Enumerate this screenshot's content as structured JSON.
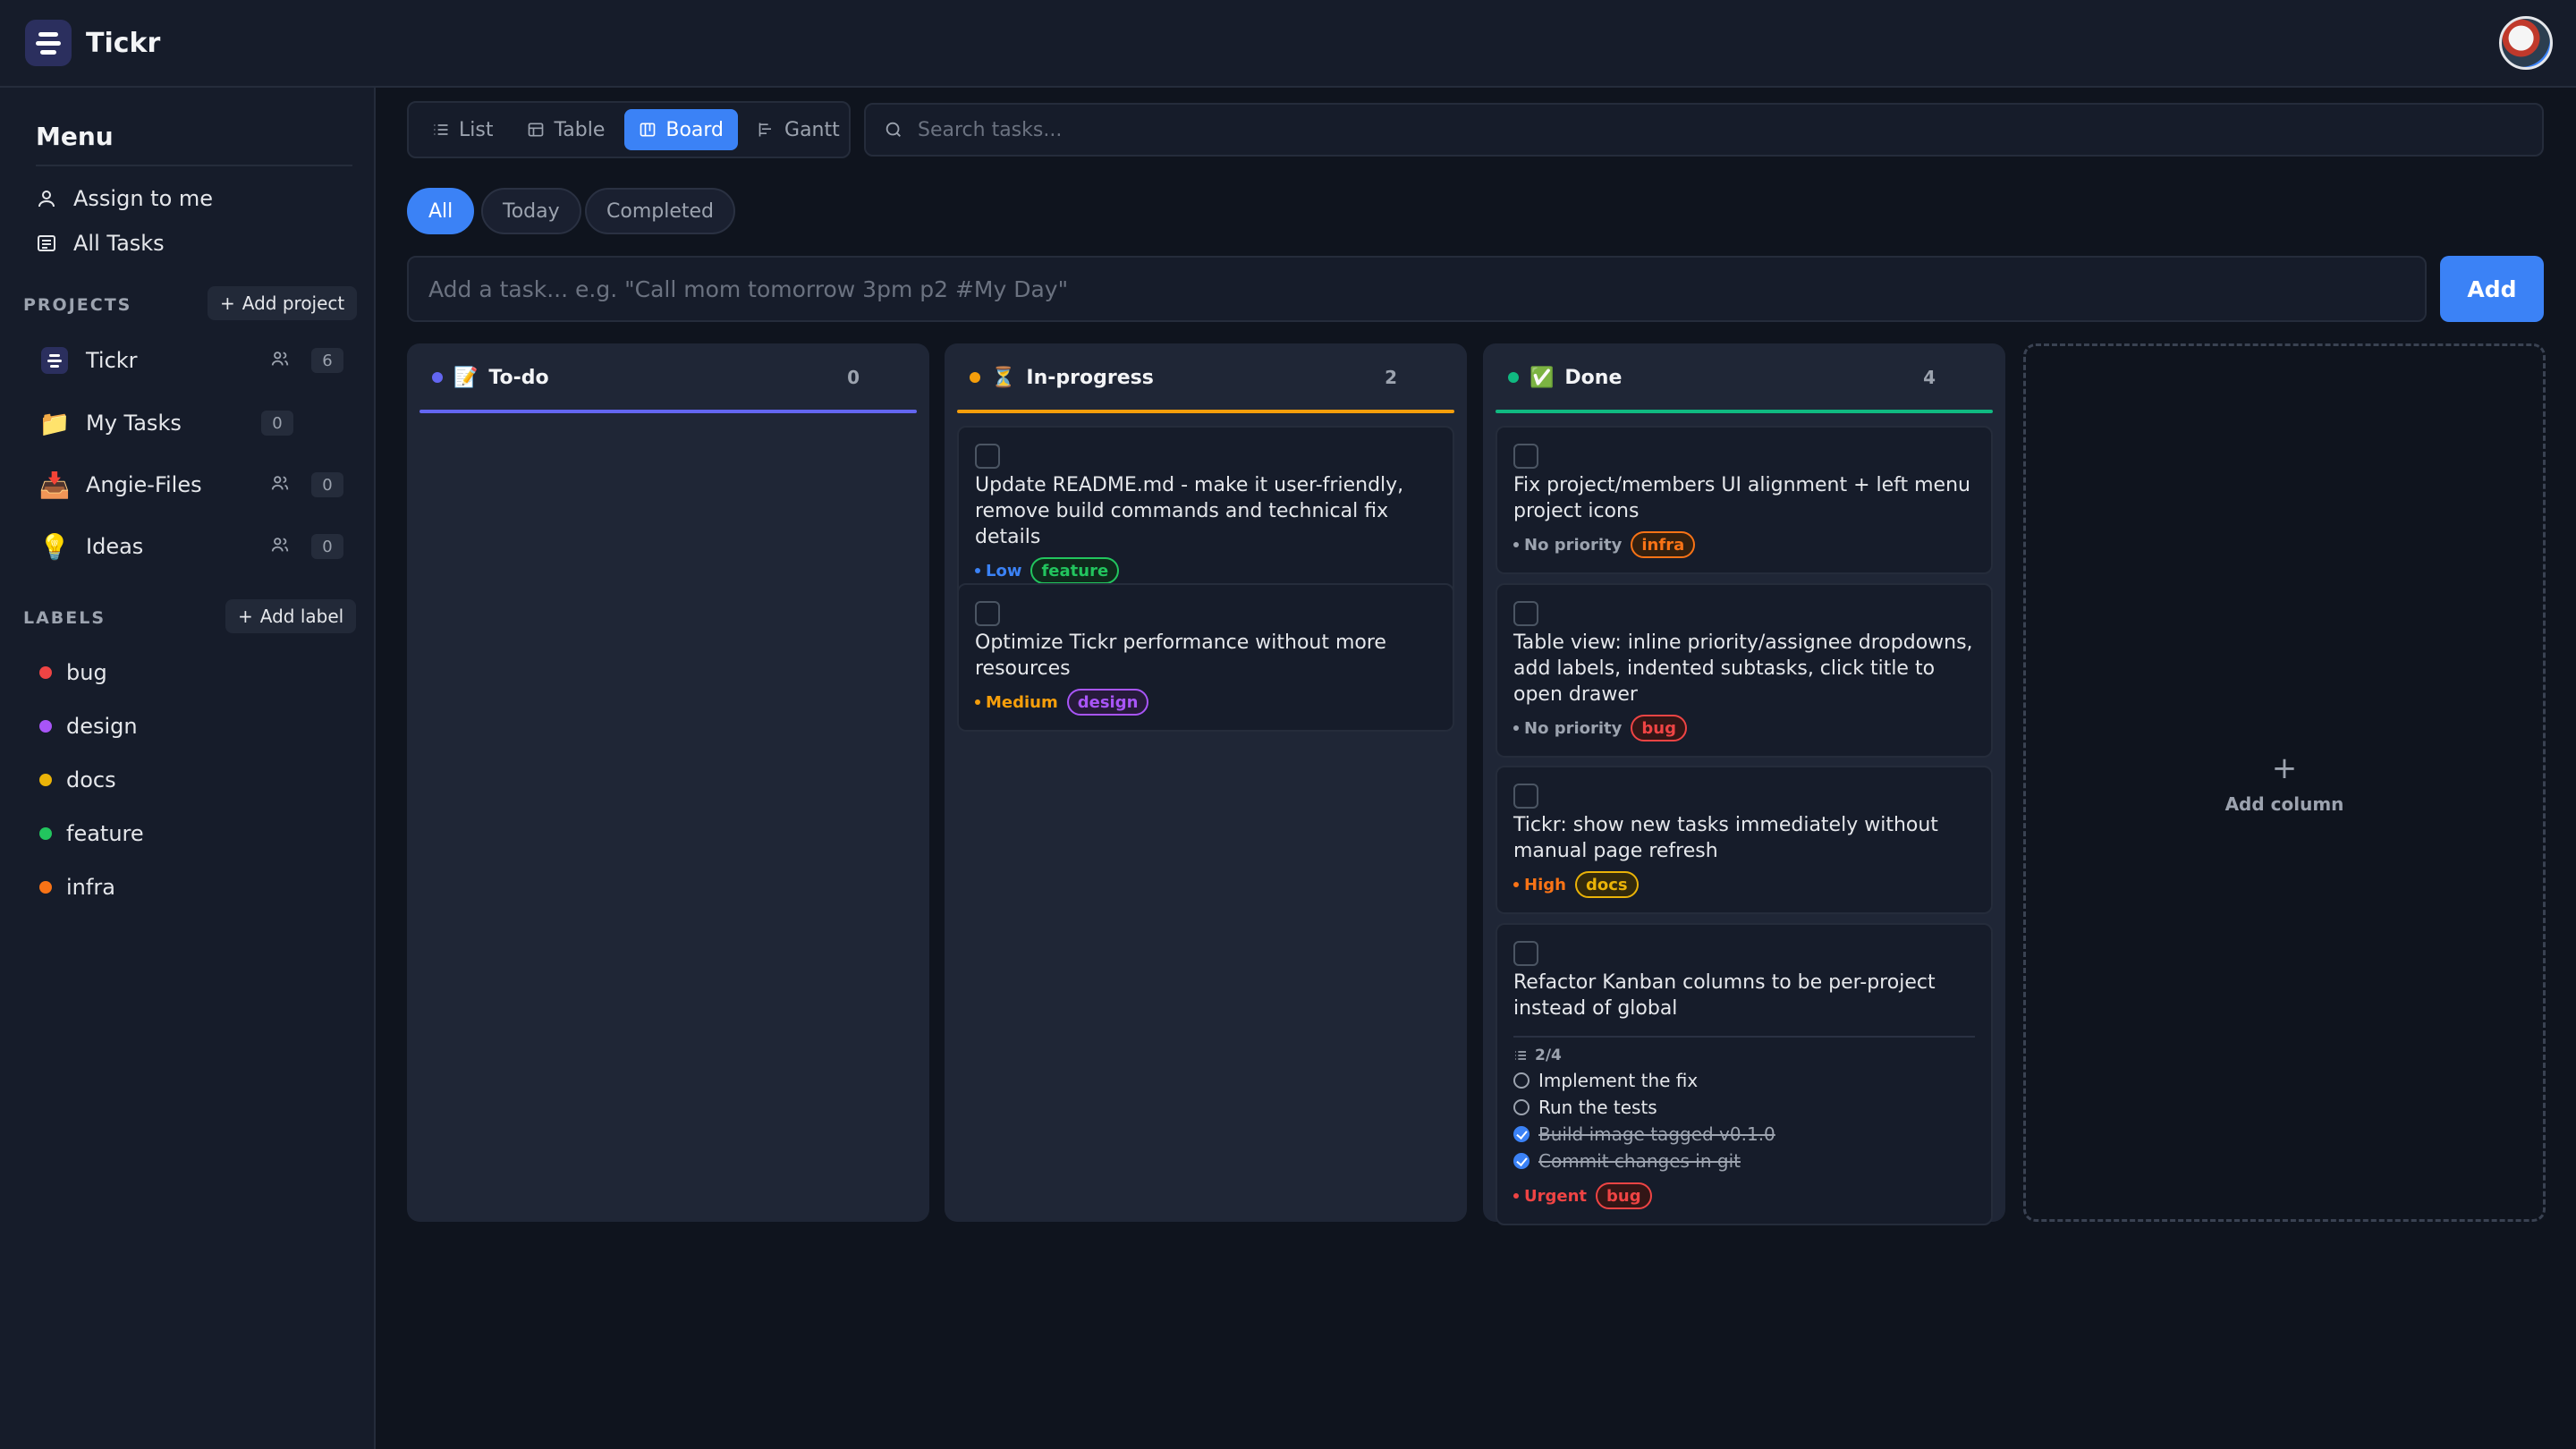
{
  "app": {
    "title": "Tickr"
  },
  "sidebar": {
    "menu_title": "Menu",
    "nav": [
      {
        "label": "Assign to me",
        "icon": "user-icon"
      },
      {
        "label": "All Tasks",
        "icon": "list-icon"
      }
    ],
    "projects_label": "PROJECTS",
    "add_project": "Add project",
    "projects": [
      {
        "name": "Tickr",
        "count": "6",
        "shared": true
      },
      {
        "name": "My Tasks",
        "count": "0",
        "shared": false
      },
      {
        "name": "Angie-Files",
        "count": "0",
        "shared": true
      },
      {
        "name": "Ideas",
        "count": "0",
        "shared": true
      }
    ],
    "labels_label": "LABELS",
    "add_label": "Add label",
    "labels": [
      {
        "name": "bug",
        "color": "#ef4444"
      },
      {
        "name": "design",
        "color": "#a855f7"
      },
      {
        "name": "docs",
        "color": "#eab308"
      },
      {
        "name": "feature",
        "color": "#22c55e"
      },
      {
        "name": "infra",
        "color": "#f97316"
      }
    ]
  },
  "views": {
    "list": "List",
    "table": "Table",
    "board": "Board",
    "gantt": "Gantt",
    "active": "Board"
  },
  "search": {
    "placeholder": "Search tasks..."
  },
  "filters": {
    "all": "All",
    "today": "Today",
    "completed": "Completed",
    "active": "All"
  },
  "add_task": {
    "placeholder": "Add a task... e.g. \"Call mom tomorrow 3pm p2 #My Day\"",
    "button": "Add"
  },
  "board": {
    "columns": [
      {
        "name": "To-do",
        "emoji": "📝",
        "count": "0",
        "color": "#6366f1",
        "cards": []
      },
      {
        "name": "In-progress",
        "emoji": "⏳",
        "count": "2",
        "color": "#f59e0b",
        "cards": [
          {
            "title": "Update README.md - make it user-friendly, remove build commands and technical fix details",
            "priority": "Low",
            "tag": "feature"
          },
          {
            "title": "Optimize Tickr performance without more resources",
            "priority": "Medium",
            "tag": "design"
          }
        ]
      },
      {
        "name": "Done",
        "emoji": "✅",
        "count": "4",
        "color": "#10b981",
        "cards": [
          {
            "title": "Fix project/members UI alignment + left menu project icons",
            "priority": "No priority",
            "tag": "infra"
          },
          {
            "title": "Table view: inline priority/assignee dropdowns, add labels, indented subtasks, click title to open drawer",
            "priority": "No priority",
            "tag": "bug"
          },
          {
            "title": "Tickr: show new tasks immediately without manual page refresh",
            "priority": "High",
            "tag": "docs"
          },
          {
            "title": "Refactor Kanban columns to be per-project instead of global",
            "priority": "Urgent",
            "tag": "bug",
            "subtask_progress": "2/4",
            "subtasks": [
              {
                "text": "Implement the fix",
                "done": false
              },
              {
                "text": "Run the tests",
                "done": false
              },
              {
                "text": "Build image tagged v0.1.0",
                "done": true
              },
              {
                "text": "Commit changes in git",
                "done": true
              }
            ]
          }
        ]
      }
    ],
    "add_column": "Add column"
  },
  "colors": {
    "accent": "#3b82f6",
    "priority_low": "#3b82f6",
    "priority_medium": "#f59e0b",
    "priority_high": "#f97316",
    "priority_urgent": "#ef4444",
    "priority_none": "#9ca3af"
  }
}
